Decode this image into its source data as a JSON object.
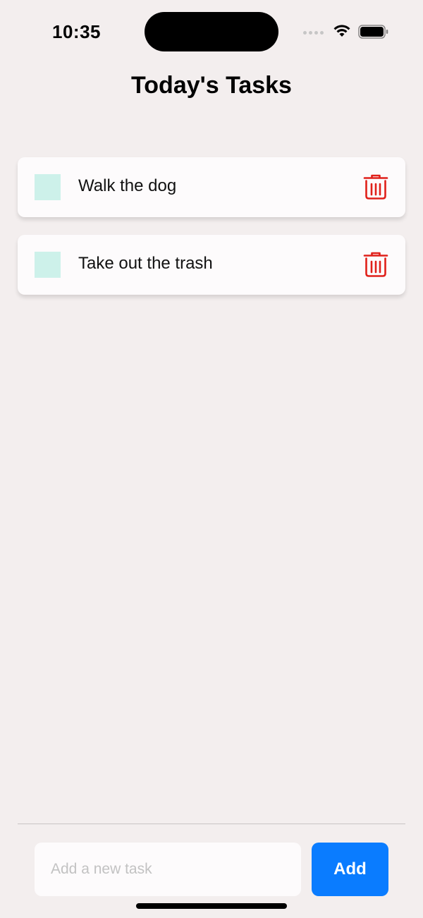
{
  "status_bar": {
    "time": "10:35",
    "icons": [
      "signal-icon",
      "wifi-icon",
      "battery-icon"
    ]
  },
  "header": {
    "title": "Today's Tasks"
  },
  "tasks": [
    {
      "label": "Walk the dog",
      "checked": false
    },
    {
      "label": "Take out the trash",
      "checked": false
    }
  ],
  "composer": {
    "input_value": "",
    "input_placeholder": "Add a new task",
    "add_label": "Add"
  },
  "colors": {
    "background": "#f3eeee",
    "card": "#fdfbfc",
    "checkbox": "#cdf1ea",
    "delete": "#e0201a",
    "accent": "#0a7cff"
  }
}
